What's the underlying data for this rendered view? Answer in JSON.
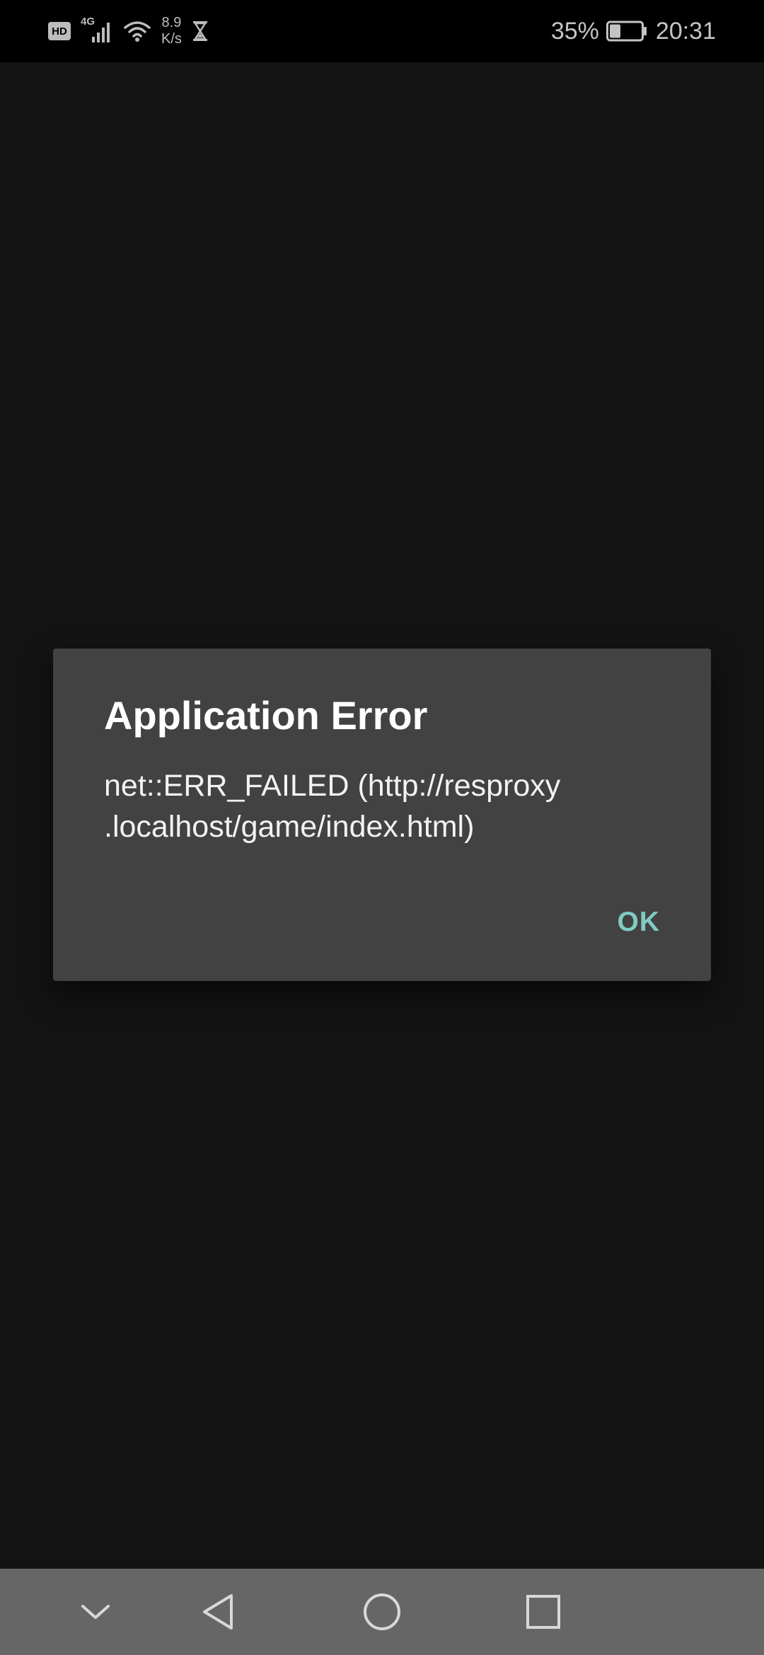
{
  "status_bar": {
    "hd_label": "HD",
    "network_type": "4G",
    "speed_value": "8.9",
    "speed_unit": "K/s",
    "battery_percent": "35%",
    "battery_level": 0.35,
    "time": "20:31",
    "icons": [
      "hd-icon",
      "signal-4g-icon",
      "wifi-icon",
      "hourglass-icon",
      "battery-icon"
    ]
  },
  "dialog": {
    "title": "Application Error",
    "message_line1": "net::ERR_FAILED (http://resproxy",
    "message_line2": ".localhost/game/index.html)",
    "ok_label": "OK"
  },
  "nav_bar": {
    "icons": [
      "chevron-down-icon",
      "back-icon",
      "home-icon",
      "recents-icon"
    ]
  },
  "colors": {
    "background": "#131313",
    "status_bar": "#000000",
    "dialog": "#424242",
    "accent": "#80cbc4",
    "nav_bar": "#666666"
  }
}
